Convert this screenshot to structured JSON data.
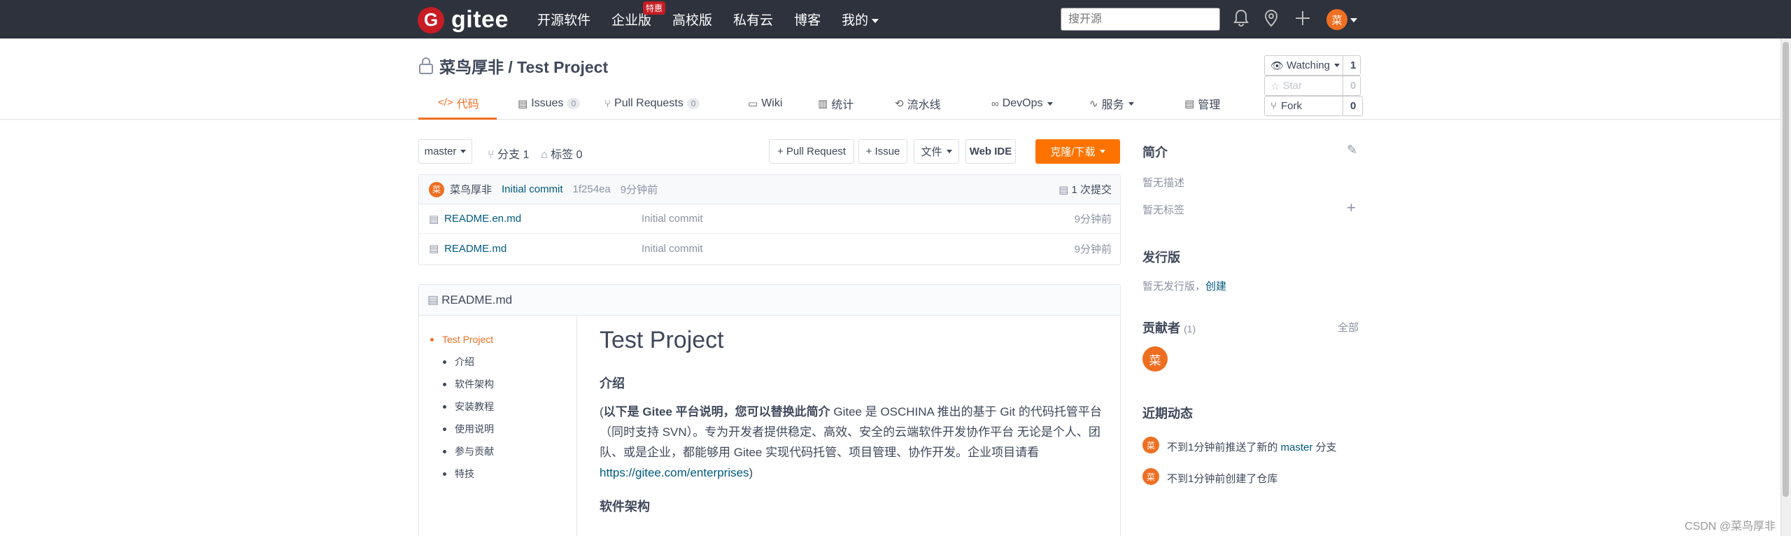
{
  "topnav": {
    "logo_text": "gitee",
    "logo_letter": "G",
    "links": [
      "开源软件",
      "企业版",
      "高校版",
      "私有云",
      "博客",
      "我的"
    ],
    "badge": "特惠",
    "search_placeholder": "搜开源",
    "avatar_letter": "菜"
  },
  "repo": {
    "title": "菜鸟厚非 / Test Project",
    "watch_label": "Watching",
    "watch_count": "1",
    "star_label": "Star",
    "star_count": "0",
    "fork_label": "Fork",
    "fork_count": "0"
  },
  "tabs": [
    {
      "label": "代码",
      "icon": "</>"
    },
    {
      "label": "Issues",
      "count": "0",
      "icon": "▤"
    },
    {
      "label": "Pull Requests",
      "count": "0",
      "icon": "⑂"
    },
    {
      "label": "Wiki",
      "icon": "▭"
    },
    {
      "label": "统计",
      "icon": "▥"
    },
    {
      "label": "流水线",
      "icon": "⟲"
    },
    {
      "label": "DevOps",
      "icon": "∞"
    },
    {
      "label": "服务",
      "icon": "∿"
    },
    {
      "label": "管理",
      "icon": "▤"
    }
  ],
  "toolbar": {
    "branch": "master",
    "branches": "分支 1",
    "tags": "标签 0",
    "pull_request": "+ Pull Request",
    "issue": "+ Issue",
    "file": "文件",
    "web_ide": "Web IDE",
    "clone": "克隆/下载"
  },
  "commit": {
    "author": "菜鸟厚非",
    "message": "Initial commit",
    "hash": "1f254ea",
    "time": "9分钟前",
    "count": "1 次提交",
    "avatar_letter": "菜"
  },
  "files": [
    {
      "name": "README.en.md",
      "message": "Initial commit",
      "time": "9分钟前"
    },
    {
      "name": "README.md",
      "message": "Initial commit",
      "time": "9分钟前"
    }
  ],
  "readme": {
    "filename": "README.md",
    "toc": [
      "Test Project",
      "介绍",
      "软件架构",
      "安装教程",
      "使用说明",
      "参与贡献",
      "特技"
    ],
    "title": "Test Project",
    "h_intro": "介绍",
    "intro_bold": "以下是 Gitee 平台说明，您可以替换此简介",
    "intro_text": " Gitee 是 OSCHINA 推出的基于 Git 的代码托管平台（同时支持 SVN）。专为开发者提供稳定、高效、安全的云端软件开发协作平台 无论是个人、团队、或是企业，都能够用 Gitee 实现代码托管、项目管理、协作开发。企业项目请看 ",
    "intro_link": "https://gitee.com/enterprises",
    "h_arch": "软件架构"
  },
  "sidebar": {
    "intro_title": "简介",
    "no_desc": "暂无描述",
    "no_tags": "暂无标签",
    "release_title": "发行版",
    "no_release": "暂无发行版，",
    "create": "创建",
    "contrib_title": "贡献者",
    "contrib_count": "(1)",
    "all": "全部",
    "contrib_letter": "菜",
    "activity_title": "近期动态",
    "activity1_pre": "不到1分钟前推送了新的 ",
    "activity1_link": "master",
    "activity1_post": " 分支",
    "activity2": "不到1分钟前创建了仓库",
    "activity_letter": "菜"
  },
  "watermark": "CSDN @菜鸟厚非",
  "colors": {
    "accent": "#ee6f22",
    "clone_button": "#fe7300",
    "nav_bg": "#2e323d",
    "link": "#005980"
  }
}
